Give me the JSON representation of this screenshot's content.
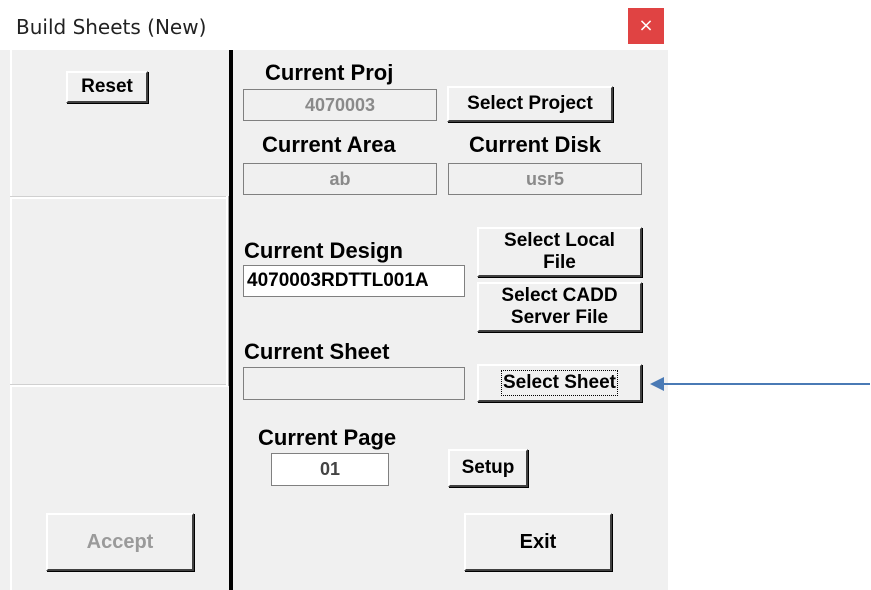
{
  "window": {
    "title": "Build Sheets (New)",
    "close_glyph": "×"
  },
  "left": {
    "reset_label": "Reset",
    "accept_label": "Accept"
  },
  "project": {
    "label": "Current Proj",
    "value": "4070003",
    "select_label": "Select Project"
  },
  "area": {
    "label": "Current Area",
    "value": "ab"
  },
  "disk": {
    "label": "Current Disk",
    "value": "usr5"
  },
  "design": {
    "label": "Current  Design",
    "value": "4070003RDTTL001A",
    "local_label_1": "Select Local",
    "local_label_2": "File",
    "cadd_label_1": "Select CADD",
    "cadd_label_2": "Server File"
  },
  "sheet": {
    "label": "Current Sheet",
    "value": "",
    "select_label": "Select Sheet"
  },
  "page": {
    "label": "Current Page",
    "value": "01",
    "setup_label": "Setup"
  },
  "exit_label": "Exit",
  "colors": {
    "close_button": "#e04343",
    "arrow": "#4a7ab5",
    "separator": "#000000"
  }
}
